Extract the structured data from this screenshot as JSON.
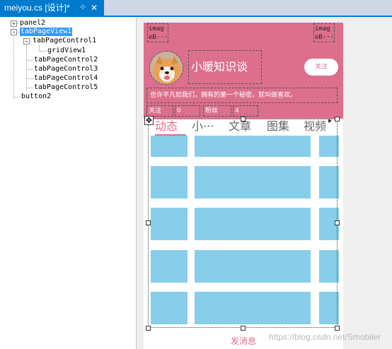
{
  "document_tab": {
    "title": "meiyou.cs [设计]*",
    "pin_glyph": "⊹",
    "close_glyph": "✕"
  },
  "tree": {
    "nodes": [
      {
        "label": "panel2",
        "expander": "+"
      },
      {
        "label": "tabPageView1",
        "expander": "−",
        "selected": true
      },
      {
        "label": "tabPageControl1",
        "expander": "−"
      },
      {
        "label": "gridView1"
      },
      {
        "label": "tabPageControl2"
      },
      {
        "label": "tabPageControl3"
      },
      {
        "label": "tabPageControl4"
      },
      {
        "label": "tabPageControl5"
      },
      {
        "label": "button2"
      }
    ]
  },
  "profile": {
    "image_placeholder": "imag eB···",
    "name": "小暖知识谈",
    "follow_button": "关注",
    "bio": "也许平凡如我们，拥有的第一个秘密，就叫做喜欢。",
    "stats": {
      "follow_label": "关注",
      "follow_value": "0",
      "fans_label": "粉丝",
      "fans_value": "4"
    }
  },
  "tabs": [
    "动态",
    "小···",
    "文章",
    "图集",
    "视频"
  ],
  "send_button": "发消息",
  "watermark": "https://blog.csdn.net/Smobiler",
  "colors": {
    "accent": "#dc6f8d",
    "tile": "#87ceeb",
    "selection": "#3399ff",
    "tab_strip": "#007acc"
  }
}
